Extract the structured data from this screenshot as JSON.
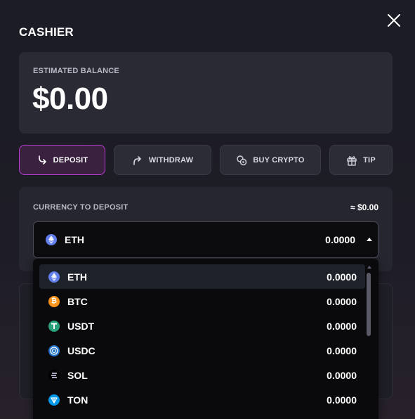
{
  "header": {
    "title": "CASHIER",
    "close_icon": "close-icon"
  },
  "balance": {
    "label": "ESTIMATED BALANCE",
    "value": "$0.00"
  },
  "tabs": [
    {
      "label": "DEPOSIT",
      "icon": "arrow-down-right-icon",
      "active": true
    },
    {
      "label": "WITHDRAW",
      "icon": "arrow-up-right-icon",
      "active": false
    },
    {
      "label": "BUY CRYPTO",
      "icon": "coins-icon",
      "active": false
    },
    {
      "label": "TIP",
      "icon": "gift-icon",
      "active": false
    }
  ],
  "deposit": {
    "currency_label": "CURRENCY TO DEPOSIT",
    "usd_value": "≈ $0.00",
    "selected": {
      "symbol": "ETH",
      "amount": "0.0000",
      "icon": "eth-icon"
    }
  },
  "currencies": [
    {
      "symbol": "ETH",
      "amount": "0.0000",
      "icon": "eth-icon",
      "color": "#627eea"
    },
    {
      "symbol": "BTC",
      "amount": "0.0000",
      "icon": "btc-icon",
      "color": "#f7931a"
    },
    {
      "symbol": "USDT",
      "amount": "0.0000",
      "icon": "usdt-icon",
      "color": "#26a17b"
    },
    {
      "symbol": "USDC",
      "amount": "0.0000",
      "icon": "usdc-icon",
      "color": "#2775ca"
    },
    {
      "symbol": "SOL",
      "amount": "0.0000",
      "icon": "sol-icon",
      "color": "#000000"
    },
    {
      "symbol": "TON",
      "amount": "0.0000",
      "icon": "ton-icon",
      "color": "#0098ea"
    }
  ],
  "colors": {
    "accent": "#b93ed6",
    "background": "#1b1c25",
    "card": "#2a2a35"
  }
}
